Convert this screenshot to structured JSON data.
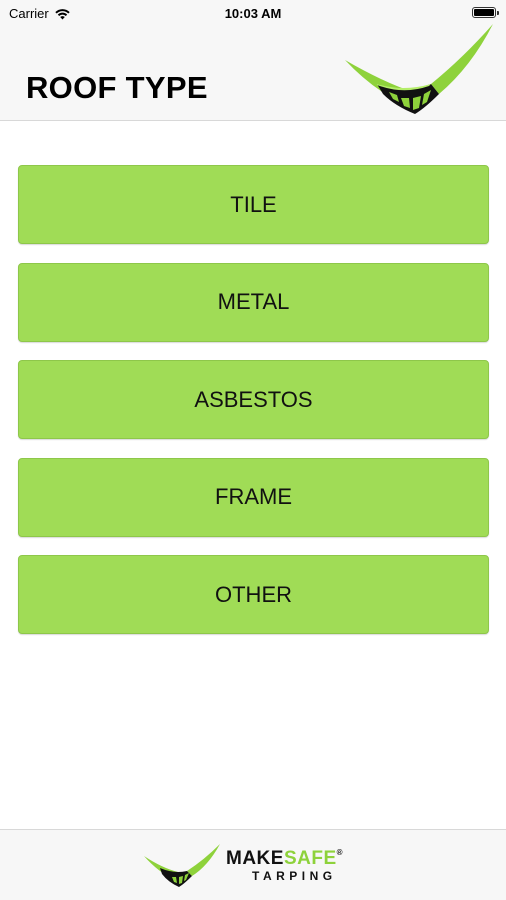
{
  "status_bar": {
    "carrier": "Carrier",
    "time": "10:03 AM",
    "wifi_icon": "wifi-icon",
    "battery_icon": "battery-icon",
    "battery_level": 1.0
  },
  "header": {
    "title": "ROOF TYPE",
    "logo_icon": "makesafe-logo-icon"
  },
  "options": [
    {
      "label": "TILE"
    },
    {
      "label": "METAL"
    },
    {
      "label": "ASBESTOS"
    },
    {
      "label": "FRAME"
    },
    {
      "label": "OTHER"
    }
  ],
  "footer": {
    "brand_make": "MAKE",
    "brand_safe": "SAFE",
    "brand_reg": "®",
    "brand_sub": "TARPING",
    "logo_icon": "makesafe-logo-icon"
  },
  "colors": {
    "button_green": "#a0dc56",
    "brand_green": "#8ed23b",
    "header_bg": "#f7f7f7"
  }
}
